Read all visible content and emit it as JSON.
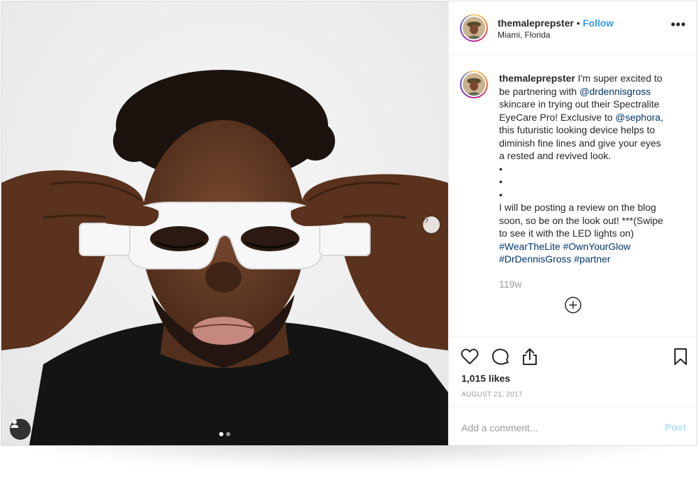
{
  "post": {
    "username": "themaleprepster",
    "separator": "•",
    "follow_label": "Follow",
    "location": "Miami, Florida",
    "more_label": "•••"
  },
  "caption": {
    "username": "themaleprepster",
    "line1": " I'm super excited to",
    "line2_pre": "be partnering with ",
    "mention1": "@drdennisgross",
    "line3": "skincare in trying out their Spectralite",
    "line4_pre": "EyeCare Pro! Exclusive to ",
    "mention2": "@sephora",
    "line4_post": ",",
    "line5": "this futuristic looking device helps to",
    "line6": "diminish fine lines and give your eyes",
    "line7": "a rested and revived look.",
    "bullet": "•",
    "line8": "I will be posting a review on the blog",
    "line9": "soon, so be on the look out! ***(Swipe",
    "line10": "to see it with the LED lights on)",
    "hashtag1": "#WearTheLite",
    "hashtag2": "#OwnYourGlow",
    "hashtag3": "#DrDennisGross",
    "hashtag4": "#partner",
    "time_ago": "119w"
  },
  "actions": {
    "like_icon": "heart-icon",
    "comment_icon": "comment-icon",
    "share_icon": "share-icon",
    "save_icon": "bookmark-icon",
    "likes": "1,015 likes",
    "date": "AUGUST 21, 2017"
  },
  "comment_box": {
    "placeholder": "Add a comment...",
    "post_label": "Post"
  },
  "carousel": {
    "current_slide": 1,
    "total_slides": 2
  },
  "colors": {
    "follow": "#3897f0",
    "link": "#003569",
    "muted": "#999999",
    "post_disabled": "#b2dffc"
  }
}
